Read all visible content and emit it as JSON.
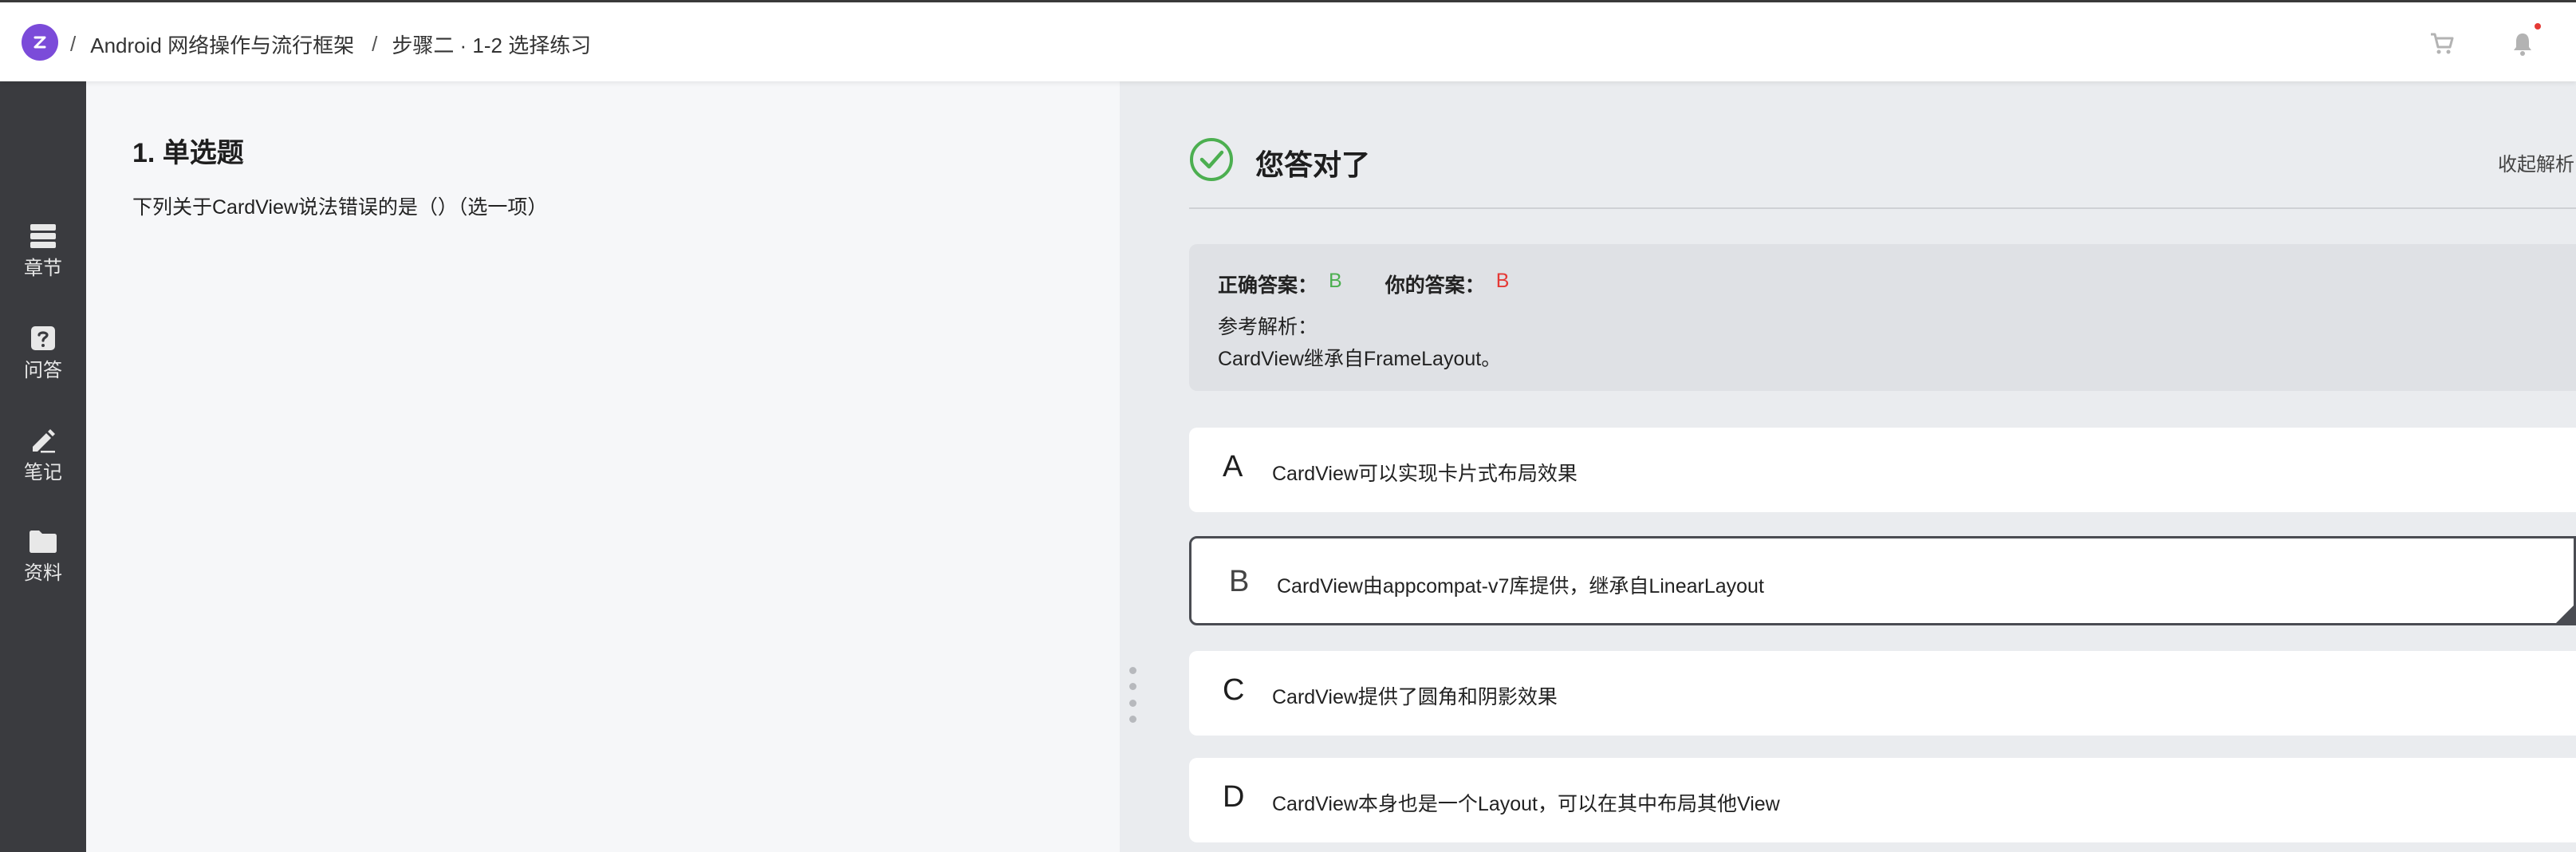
{
  "header": {
    "breadcrumb": [
      {
        "sep": "/",
        "label": "Android 网络操作与流行框架"
      },
      {
        "sep": "/",
        "label": "步骤二 · 1-2 选择练习"
      }
    ],
    "icons": [
      "logo-icon",
      "cart-icon",
      "bell-icon"
    ]
  },
  "sidebar": {
    "items": [
      {
        "label": "章节",
        "icon": "chapters-icon"
      },
      {
        "label": "问答",
        "icon": "question-icon"
      },
      {
        "label": "笔记",
        "icon": "pencil-icon"
      },
      {
        "label": "资料",
        "icon": "folder-icon"
      }
    ]
  },
  "question": {
    "title": "1. 单选题",
    "text": "下列关于CardView说法错误的是（）（选一项）"
  },
  "result": {
    "title": "您答对了",
    "collapse_label": "收起解析",
    "correct_label": "正确答案：",
    "correct_value": "B",
    "your_label": "你的答案：",
    "your_value": "B",
    "reference_label": "参考解析：",
    "reference_text": "CardView继承自FrameLayout。"
  },
  "options": [
    {
      "letter": "A",
      "text": "CardView可以实现卡片式布局效果",
      "selected": false
    },
    {
      "letter": "B",
      "text": "CardView由appcompat-v7库提供，继承自LinearLayout",
      "selected": true
    },
    {
      "letter": "C",
      "text": "CardView提供了圆角和阴影效果",
      "selected": false
    },
    {
      "letter": "D",
      "text": "CardView本身也是一个Layout，可以在其中布局其他View",
      "selected": false
    }
  ],
  "colors": {
    "brand": "#7b4bd9",
    "correct": "#4caf50",
    "wrong": "#e53935",
    "sidebar_bg": "#3a3b3f"
  }
}
